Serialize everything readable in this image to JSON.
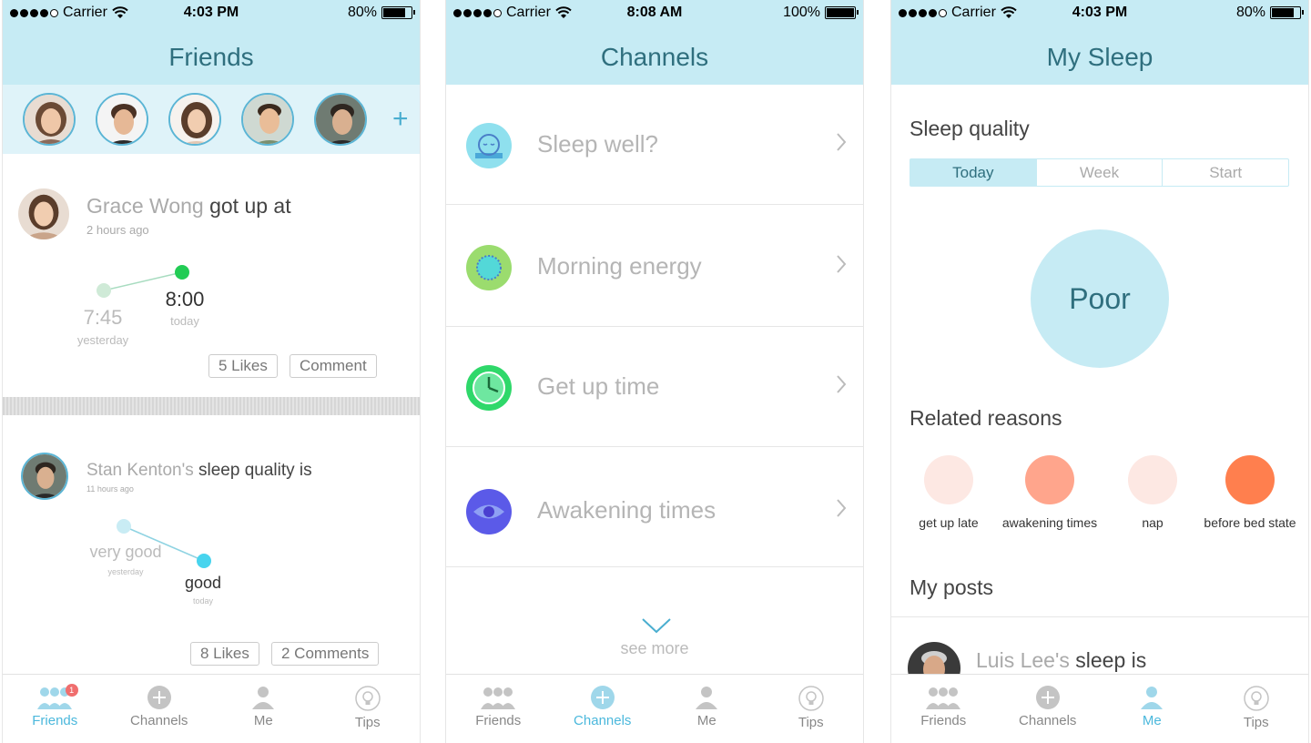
{
  "status_bars": [
    {
      "carrier": "Carrier",
      "time": "4:03 PM",
      "battery": "80%",
      "battery_level": 0.8
    },
    {
      "carrier": "Carrier",
      "time": "8:08 AM",
      "battery": "100%",
      "battery_level": 1.0
    },
    {
      "carrier": "Carrier",
      "time": "4:03 PM",
      "battery": "80%",
      "battery_level": 0.8
    }
  ],
  "friends": {
    "title": "Friends",
    "add_symbol": "+",
    "posts": [
      {
        "name": "Grace Wong",
        "action": " got up at",
        "time_ago": "2 hours ago",
        "prev_value": "7:45",
        "prev_label": "yesterday",
        "curr_value": "8:00",
        "curr_label": "today",
        "likes": "5 Likes",
        "comments": "Comment"
      },
      {
        "name": "Stan Kenton's",
        "action": " sleep quality is",
        "time_ago": "11 hours ago",
        "prev_value": "very good",
        "prev_label": "yesterday",
        "curr_value": "good",
        "curr_label": "today",
        "likes": "8 Likes",
        "comments": "2 Comments"
      }
    ]
  },
  "channels": {
    "title": "Channels",
    "items": [
      {
        "label": "Sleep well?",
        "icon": "sleeping-face-icon",
        "color": "#8fe0ee"
      },
      {
        "label": "Morning energy",
        "icon": "sun-icon",
        "color": "#9bdc6e"
      },
      {
        "label": "Get up time",
        "icon": "clock-icon",
        "color": "#2fd86a"
      },
      {
        "label": "Awakening times",
        "icon": "eye-icon",
        "color": "#5b5ae8"
      }
    ],
    "see_more": "see more"
  },
  "my_sleep": {
    "title": "My Sleep",
    "sleep_quality_heading": "Sleep quality",
    "segments": [
      "Today",
      "Week",
      "Start"
    ],
    "active_segment": "Today",
    "quality": "Poor",
    "related_heading": "Related reasons",
    "reasons": [
      {
        "label": "get up late",
        "color": "#fde8e3"
      },
      {
        "label": "awakening times",
        "color": "#ffa58c"
      },
      {
        "label": "nap",
        "color": "#fde8e3"
      },
      {
        "label": "before bed state",
        "color": "#ff7f4e"
      }
    ],
    "posts_heading": "My posts",
    "post": {
      "name": "Luis Lee's",
      "action": " sleep is"
    }
  },
  "tabs": {
    "friends": "Friends",
    "channels": "Channels",
    "me": "Me",
    "tips": "Tips",
    "friends_badge": "1"
  },
  "colors": {
    "nav_bg": "#c6ebf4",
    "accent": "#4bb8dc",
    "title": "#2f6f7e"
  }
}
